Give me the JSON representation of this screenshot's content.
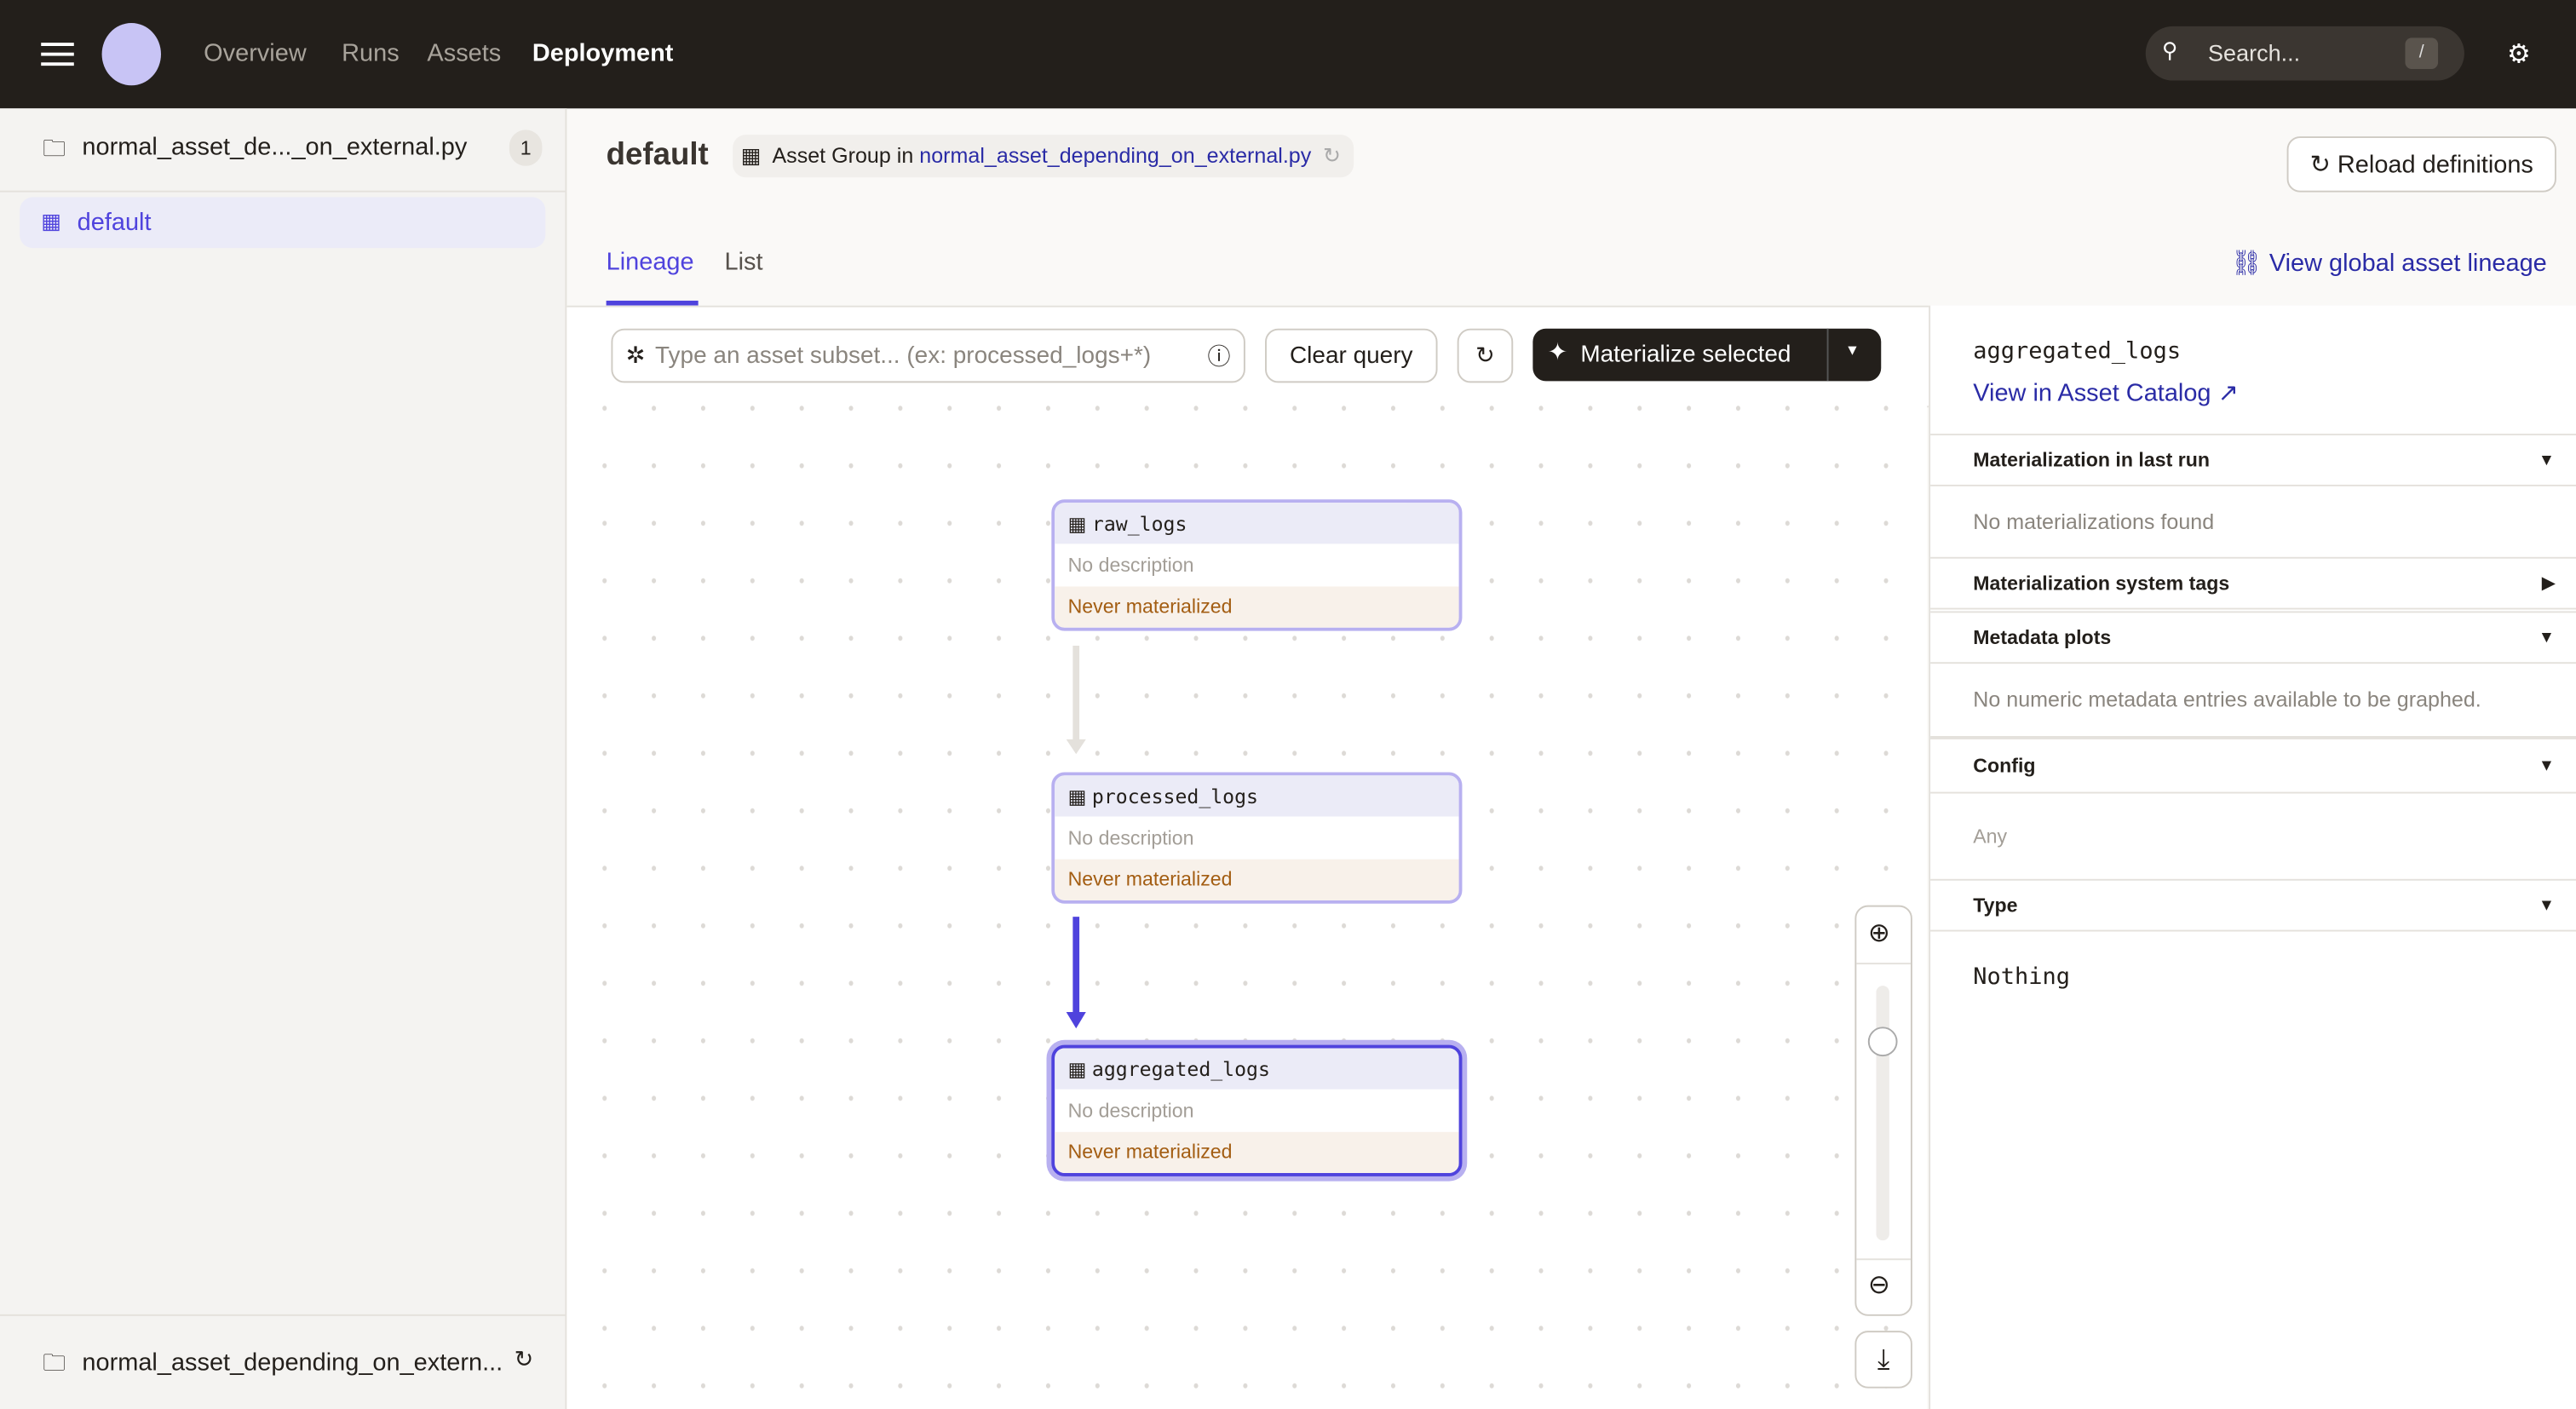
{
  "topnav": {
    "items": [
      "Overview",
      "Runs",
      "Assets",
      "Deployment"
    ],
    "active": "Deployment",
    "search_placeholder": "Search...",
    "search_shortcut": "/"
  },
  "sidebar": {
    "location": "normal_asset_de..._on_external.py",
    "location_count": "1",
    "groups": [
      {
        "label": "default"
      }
    ],
    "footer_location": "normal_asset_depending_on_extern..."
  },
  "header": {
    "title": "default",
    "tag_prefix": "Asset Group in",
    "tag_link": "normal_asset_depending_on_external.py",
    "reload": "Reload definitions"
  },
  "tabs": [
    {
      "label": "Lineage",
      "active": true
    },
    {
      "label": "List",
      "active": false
    }
  ],
  "global_lineage": "View global asset lineage",
  "toolbar": {
    "query_placeholder": "Type an asset subset... (ex: processed_logs+*)",
    "clear": "Clear query",
    "materialize": "Materialize selected"
  },
  "graph": {
    "nodes": [
      {
        "name": "raw_logs",
        "description": "No description",
        "status": "Never materialized"
      },
      {
        "name": "processed_logs",
        "description": "No description",
        "status": "Never materialized"
      },
      {
        "name": "aggregated_logs",
        "description": "No description",
        "status": "Never materialized",
        "selected": true
      }
    ]
  },
  "panel": {
    "asset": "aggregated_logs",
    "catalog_link": "View in Asset Catalog",
    "sections": [
      {
        "title": "Materialization in last run",
        "body": "No materializations found"
      },
      {
        "title": "Materialization system tags"
      },
      {
        "title": "Metadata plots",
        "body": "No numeric metadata entries available to be graphed."
      },
      {
        "title": "Config",
        "body": "Any"
      },
      {
        "title": "Type",
        "body": "Nothing"
      }
    ]
  },
  "colors": {
    "accent": "#4f43dd",
    "topbar": "#231f1b",
    "status": "#a35d12"
  }
}
